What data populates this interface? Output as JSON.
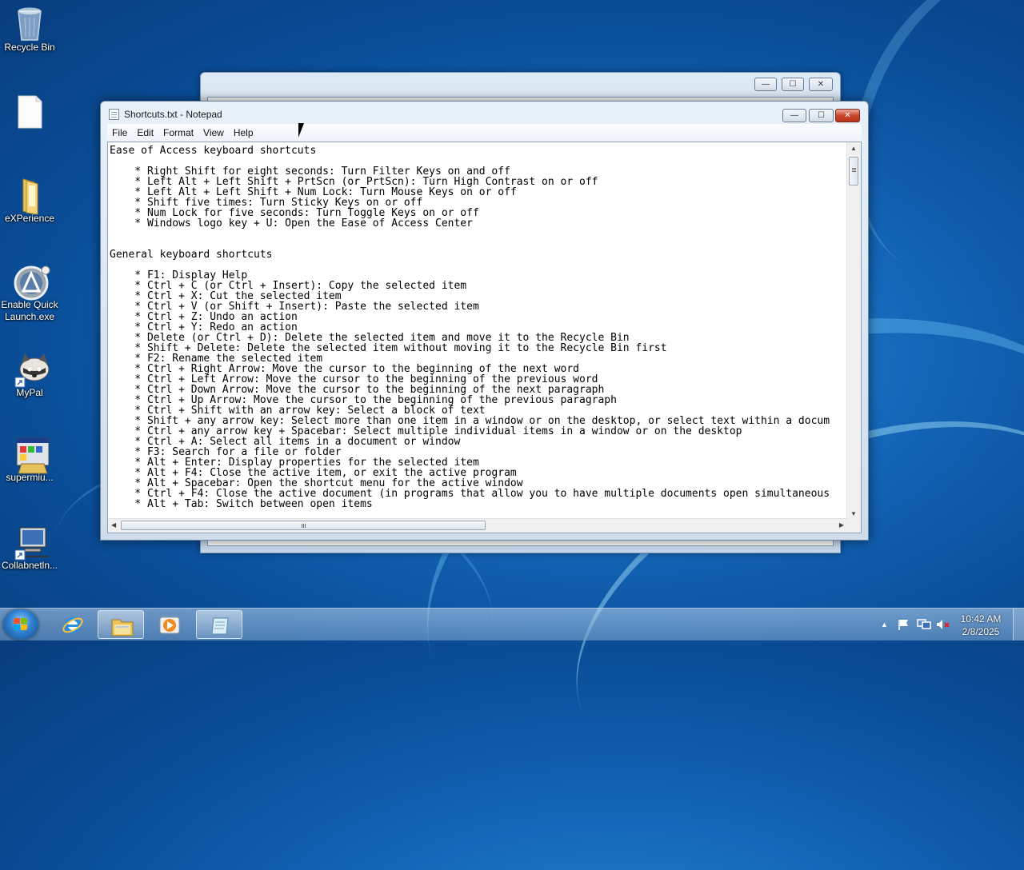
{
  "desktop": {
    "icons": [
      {
        "label": "Recycle Bin",
        "icon": "recycle-bin-icon"
      },
      {
        "label": "",
        "icon": "blank-document-icon"
      },
      {
        "label": "eXPerience",
        "icon": "folder-icon"
      },
      {
        "label": "Enable Quick Launch.exe",
        "icon": "quick-launch-app-icon"
      },
      {
        "label": "MyPal",
        "icon": "mypal-raccoon-icon"
      },
      {
        "label": "supermiu...",
        "icon": "installer-app-icon"
      },
      {
        "label": "Collabnetln...",
        "icon": "network-computer-icon"
      }
    ]
  },
  "notepad": {
    "title": "Shortcuts.txt - Notepad",
    "menu": [
      "File",
      "Edit",
      "Format",
      "View",
      "Help"
    ],
    "lines": [
      "Ease of Access keyboard shortcuts",
      "",
      "    * Right Shift for eight seconds: Turn Filter Keys on and off",
      "    * Left Alt + Left Shift + PrtScn (or PrtScn): Turn High Contrast on or off",
      "    * Left Alt + Left Shift + Num Lock: Turn Mouse Keys on or off",
      "    * Shift five times: Turn Sticky Keys on or off",
      "    * Num Lock for five seconds: Turn Toggle Keys on or off",
      "    * Windows logo key + U: Open the Ease of Access Center",
      "",
      "",
      "General keyboard shortcuts",
      "",
      "    * F1: Display Help",
      "    * Ctrl + C (or Ctrl + Insert): Copy the selected item",
      "    * Ctrl + X: Cut the selected item",
      "    * Ctrl + V (or Shift + Insert): Paste the selected item",
      "    * Ctrl + Z: Undo an action",
      "    * Ctrl + Y: Redo an action",
      "    * Delete (or Ctrl + D): Delete the selected item and move it to the Recycle Bin",
      "    * Shift + Delete: Delete the selected item without moving it to the Recycle Bin first",
      "    * F2: Rename the selected item",
      "    * Ctrl + Right Arrow: Move the cursor to the beginning of the next word",
      "    * Ctrl + Left Arrow: Move the cursor to the beginning of the previous word",
      "    * Ctrl + Down Arrow: Move the cursor to the beginning of the next paragraph",
      "    * Ctrl + Up Arrow: Move the cursor to the beginning of the previous paragraph",
      "    * Ctrl + Shift with an arrow key: Select a block of text",
      "    * Shift + any arrow key: Select more than one item in a window or on the desktop, or select text within a docum",
      "    * Ctrl + any arrow key + Spacebar: Select multiple individual items in a window or on the desktop",
      "    * Ctrl + A: Select all items in a document or window",
      "    * F3: Search for a file or folder",
      "    * Alt + Enter: Display properties for the selected item",
      "    * Alt + F4: Close the active item, or exit the active program",
      "    * Alt + Spacebar: Open the shortcut menu for the active window",
      "    * Ctrl + F4: Close the active document (in programs that allow you to have multiple documents open simultaneous",
      "    * Alt + Tab: Switch between open items"
    ]
  },
  "taskbar": {
    "pinned": [
      {
        "name": "internet-explorer-icon"
      },
      {
        "name": "windows-explorer-icon"
      },
      {
        "name": "media-player-icon"
      },
      {
        "name": "notepad-icon"
      }
    ],
    "clock": {
      "time": "10:42 AM",
      "date": "2/8/2025"
    }
  },
  "colors": {
    "accent": "#1466b8",
    "close": "#c9462c"
  }
}
